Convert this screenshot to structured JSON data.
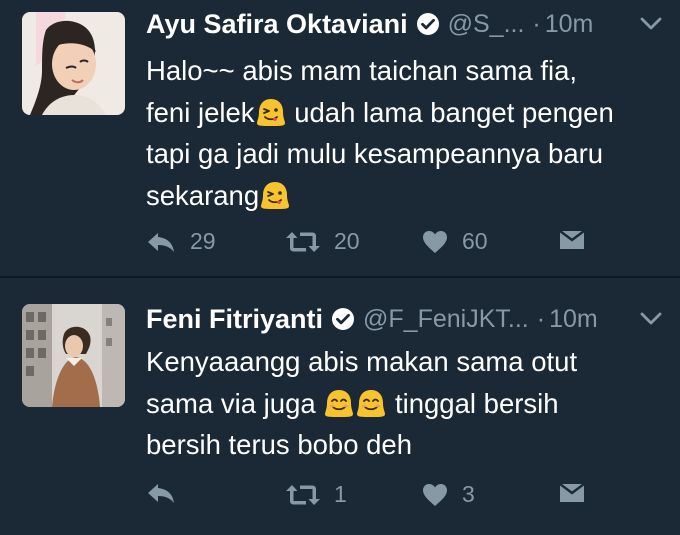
{
  "tweets": [
    {
      "name": "Ayu Safira Oktaviani",
      "handle": "@S_...",
      "dot": "·",
      "time": "10m",
      "lines": [
        "Halo~~ abis mam taichan sama fia,",
        "feni jelek",
        "udah lama banget pengen",
        "tapi ga jadi mulu kesampeannya baru",
        "sekarang"
      ],
      "replies": "29",
      "retweets": "20",
      "likes": "60"
    },
    {
      "name": "Feni Fitriyanti",
      "handle": "@F_FeniJKT...",
      "dot": "·",
      "time": "10m",
      "lines": [
        "Kenyaaangg abis makan sama otut",
        "sama via juga",
        "tinggal bersih",
        "bersih terus bobo deh"
      ],
      "replies": "",
      "retweets": "1",
      "likes": "3"
    }
  ],
  "icons": {
    "verified": "verified-badge-icon",
    "chevron": "chevron-down-icon",
    "reply": "reply-icon",
    "retweet": "retweet-icon",
    "like": "heart-icon",
    "dm": "direct-message-icon",
    "emoji_tongue": "winking-tongue-face-emoji",
    "emoji_smile": "smiling-face-emoji"
  },
  "colors": {
    "background": "#1b2836",
    "secondary_text": "#8899a6",
    "divider": "#0f1720"
  }
}
